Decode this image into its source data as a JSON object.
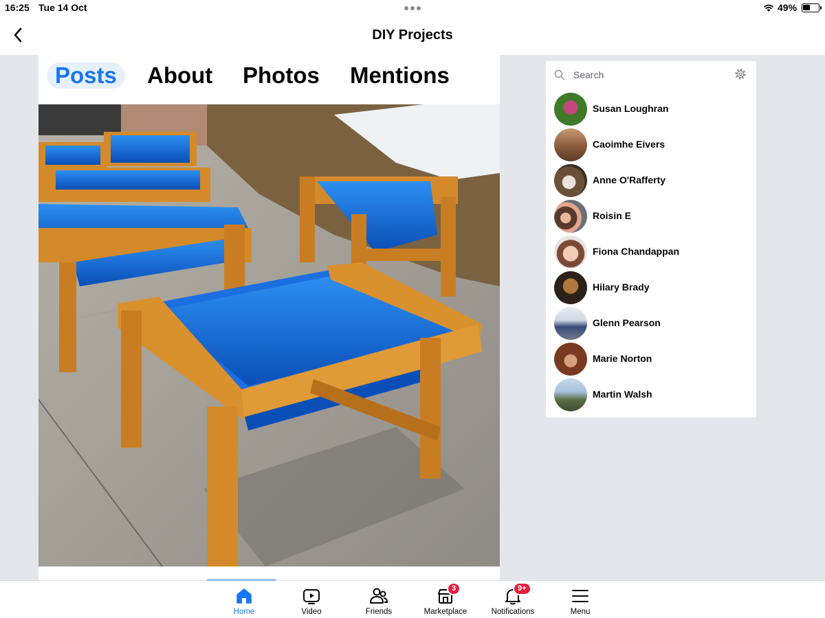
{
  "status_bar": {
    "time": "16:25",
    "date": "Tue 14 Oct",
    "battery": "49%",
    "battery_level": 0.49
  },
  "header": {
    "title": "DIY Projects"
  },
  "profile_tabs": [
    {
      "label": "Posts",
      "active": true
    },
    {
      "label": "About",
      "active": false
    },
    {
      "label": "Photos",
      "active": false
    },
    {
      "label": "Mentions",
      "active": false
    }
  ],
  "contacts": {
    "search_placeholder": "Search",
    "items": [
      {
        "name": "Susan Loughran"
      },
      {
        "name": "Caoimhe Eivers"
      },
      {
        "name": "Anne O'Rafferty"
      },
      {
        "name": "Roisin E"
      },
      {
        "name": "Fiona Chandappan"
      },
      {
        "name": "Hilary Brady"
      },
      {
        "name": "Glenn Pearson"
      },
      {
        "name": "Marie Norton"
      },
      {
        "name": "Martin Walsh"
      }
    ]
  },
  "bottom_nav": [
    {
      "label": "Home",
      "icon": "home-icon",
      "active": true
    },
    {
      "label": "Video",
      "icon": "video-icon",
      "active": false
    },
    {
      "label": "Friends",
      "icon": "friends-icon",
      "active": false
    },
    {
      "label": "Marketplace",
      "icon": "marketplace-icon",
      "badge": "3",
      "active": false
    },
    {
      "label": "Notifications",
      "icon": "bell-icon",
      "badge": "9+",
      "active": false
    },
    {
      "label": "Menu",
      "icon": "menu-icon",
      "active": false
    }
  ],
  "colors": {
    "accent": "#1877f2",
    "badge": "#e41e3f",
    "background": "#e4e6eb"
  }
}
